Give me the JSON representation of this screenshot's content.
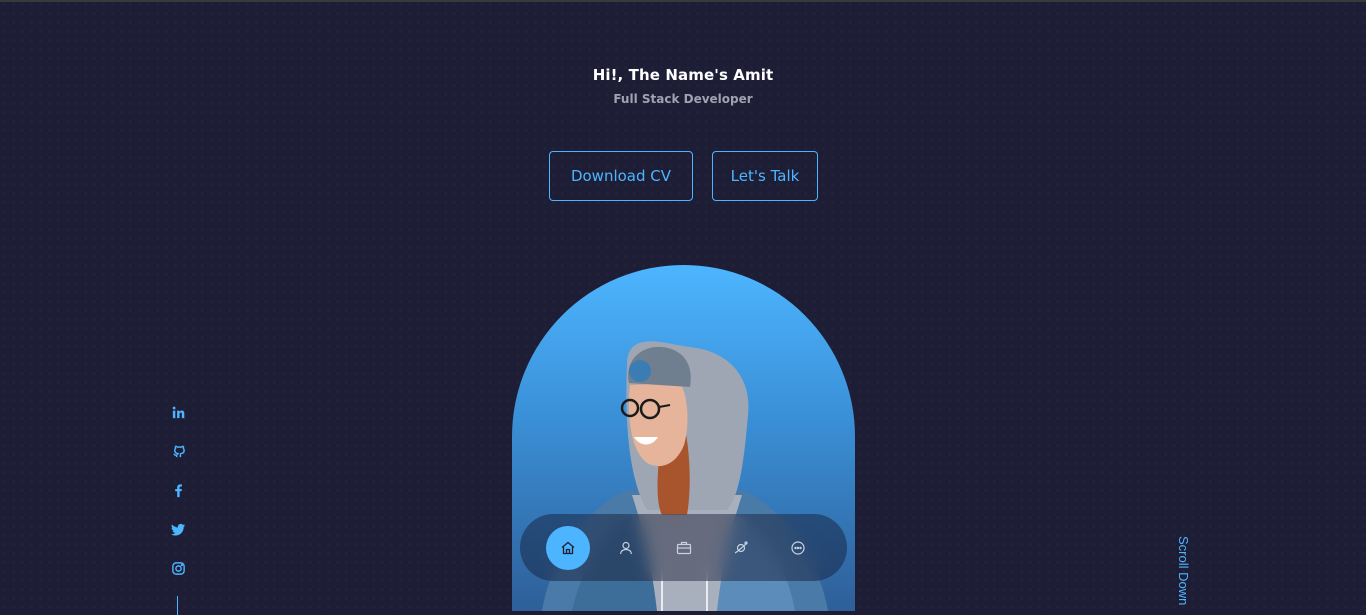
{
  "header": {
    "greeting": "Hi!, The Name's Amit",
    "role": "Full Stack Developer"
  },
  "cta": {
    "download_label": "Download CV",
    "talk_label": "Let's Talk"
  },
  "nav": {
    "items": [
      {
        "icon": "home-icon",
        "active": true
      },
      {
        "icon": "user-icon",
        "active": false
      },
      {
        "icon": "briefcase-icon",
        "active": false
      },
      {
        "icon": "satellite-icon",
        "active": false
      },
      {
        "icon": "message-icon",
        "active": false
      }
    ]
  },
  "socials": [
    "linkedin-icon",
    "github-icon",
    "facebook-icon",
    "twitter-icon",
    "instagram-icon"
  ],
  "scroll_label": "Scroll Down",
  "colors": {
    "background": "#1f1f38",
    "accent": "#4db5ff",
    "text": "#ffffff",
    "muted": "#a1a1b0"
  }
}
